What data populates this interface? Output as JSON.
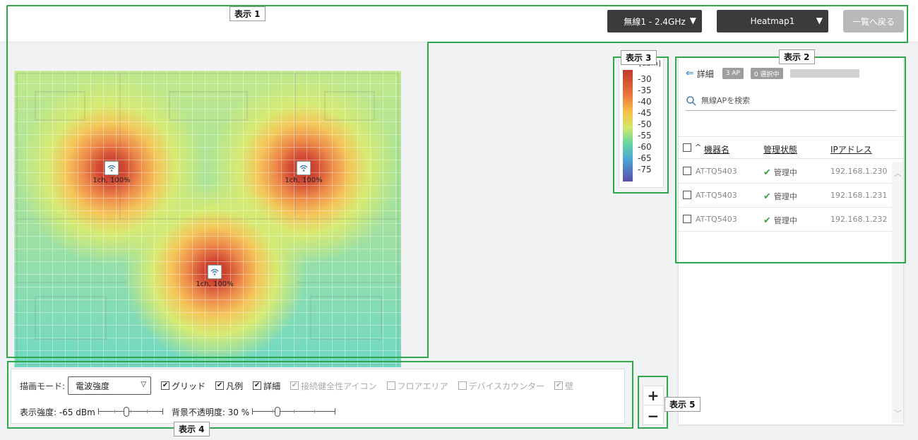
{
  "topbar": {
    "band_select": "無線1 - 2.4GHz",
    "heatmap_select": "Heatmap1",
    "back_button": "一覧へ戻る"
  },
  "map": {
    "aps": [
      {
        "label": "1ch, 100%"
      },
      {
        "label": "1ch, 100%"
      },
      {
        "label": "1ch, 100%"
      }
    ]
  },
  "legend": {
    "unit": "[dBm]",
    "ticks": [
      "-30",
      "-35",
      "-40",
      "-45",
      "-50",
      "-55",
      "-60",
      "-65",
      "-75"
    ]
  },
  "panel": {
    "detail_label": "詳細",
    "ap_count_badge": "3 AP",
    "selected_badge": "0 選択中",
    "search_placeholder": "無線APを検索",
    "columns": [
      "機器名",
      "管理状態",
      "IPアドレス"
    ],
    "rows": [
      {
        "name": "AT-TQ5403",
        "state": "管理中",
        "ip": "192.168.1.230"
      },
      {
        "name": "AT-TQ5403",
        "state": "管理中",
        "ip": "192.168.1.231"
      },
      {
        "name": "AT-TQ5403",
        "state": "管理中",
        "ip": "192.168.1.232"
      }
    ]
  },
  "controls": {
    "draw_mode_label": "描画モード:",
    "draw_mode_value": "電波強度",
    "checkboxes": {
      "grid": "グリッド",
      "legend": "凡例",
      "detail": "詳細",
      "health_icon": "接続健全性アイコン",
      "floor_area": "フロアエリア",
      "device_counter": "デバイスカウンター",
      "wall": "壁"
    },
    "strength_label": "表示強度: -65 dBm",
    "opacity_label": "背景不透明度: 30 %"
  },
  "zoom": {
    "in": "+",
    "out": "−"
  },
  "annotations": {
    "a1": "表示 1",
    "a2": "表示 2",
    "a3": "表示 3",
    "a4": "表示 4",
    "a5": "表示 5"
  },
  "colors": {
    "ok_green": "#3aa043",
    "annotation_green": "#2ea84a",
    "select_dark": "#3b3b3b",
    "link_blue": "#2d7fd6"
  }
}
